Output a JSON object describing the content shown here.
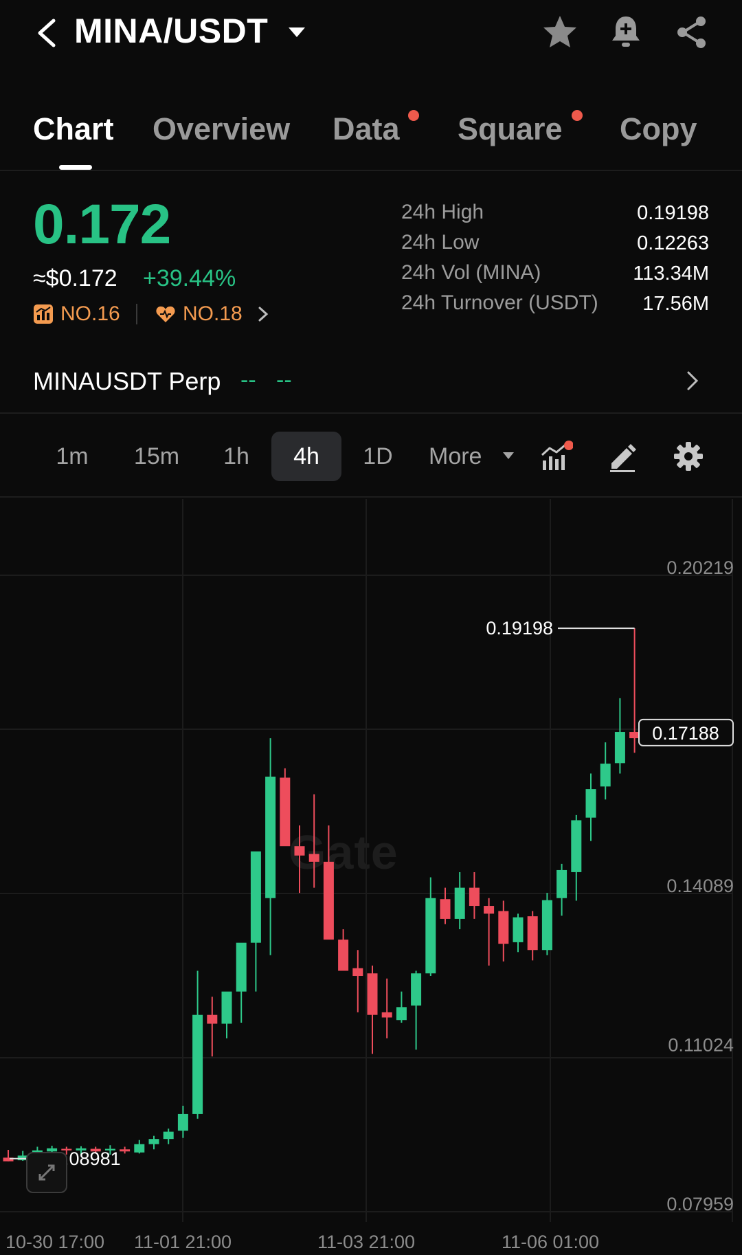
{
  "header": {
    "pair": "MINA/USDT"
  },
  "tabs": [
    {
      "label": "Chart",
      "active": true,
      "dot": false
    },
    {
      "label": "Overview",
      "active": false,
      "dot": false
    },
    {
      "label": "Data",
      "active": false,
      "dot": true
    },
    {
      "label": "Square",
      "active": false,
      "dot": true
    },
    {
      "label": "Copy",
      "active": false,
      "dot": false
    }
  ],
  "price": {
    "last": "0.172",
    "usd": "≈$0.172",
    "change": "+39.44%",
    "rank1": "NO.16",
    "rank2": "NO.18"
  },
  "stats": [
    {
      "label": "24h High",
      "value": "0.19198"
    },
    {
      "label": "24h Low",
      "value": "0.12263"
    },
    {
      "label": "24h Vol (MINA)",
      "value": "113.34M"
    },
    {
      "label": "24h Turnover (USDT)",
      "value": "17.56M"
    }
  ],
  "perp": {
    "name": "MINAUSDT Perp",
    "dash1": "--",
    "dash2": "--"
  },
  "intervals": [
    {
      "label": "1m",
      "active": false
    },
    {
      "label": "15m",
      "active": false
    },
    {
      "label": "1h",
      "active": false
    },
    {
      "label": "4h",
      "active": true
    },
    {
      "label": "1D",
      "active": false
    },
    {
      "label": "More",
      "active": false
    }
  ],
  "colors": {
    "up": "#2ec98a",
    "down": "#ee4d5c",
    "accent_green": "#28c285",
    "rank_orange": "#f49b50",
    "dot_red": "#ef5a4c"
  },
  "watermark": "Gate",
  "chart_data": {
    "type": "candlestick",
    "y_ticks": [
      "0.20219",
      "0.14089",
      "0.11024",
      "0.07959"
    ],
    "x_ticks": [
      "10-30 17:00",
      "11-01 21:00",
      "11-03 21:00",
      "11-06 01:00"
    ],
    "ylim": [
      0.07959,
      0.20219
    ],
    "high_label": "0.19198",
    "low_label": "0.08981",
    "last_price_label": "0.17188",
    "candles": [
      {
        "o": 0.09,
        "h": 0.0915,
        "l": 0.0893,
        "c": 0.0893
      },
      {
        "o": 0.0895,
        "h": 0.0913,
        "l": 0.0894,
        "c": 0.0904
      },
      {
        "o": 0.0905,
        "h": 0.0921,
        "l": 0.0898,
        "c": 0.0914
      },
      {
        "o": 0.0912,
        "h": 0.0923,
        "l": 0.0906,
        "c": 0.0918
      },
      {
        "o": 0.0917,
        "h": 0.0921,
        "l": 0.0906,
        "c": 0.0914
      },
      {
        "o": 0.0914,
        "h": 0.0922,
        "l": 0.0906,
        "c": 0.0918
      },
      {
        "o": 0.0917,
        "h": 0.0921,
        "l": 0.0908,
        "c": 0.0912
      },
      {
        "o": 0.0914,
        "h": 0.0924,
        "l": 0.0906,
        "c": 0.0917
      },
      {
        "o": 0.0916,
        "h": 0.0921,
        "l": 0.0908,
        "c": 0.0912
      },
      {
        "o": 0.091,
        "h": 0.0934,
        "l": 0.0908,
        "c": 0.0926
      },
      {
        "o": 0.0926,
        "h": 0.0942,
        "l": 0.0916,
        "c": 0.0936
      },
      {
        "o": 0.0936,
        "h": 0.0956,
        "l": 0.0926,
        "c": 0.095
      },
      {
        "o": 0.0952,
        "h": 0.1,
        "l": 0.0938,
        "c": 0.0984
      },
      {
        "o": 0.0984,
        "h": 0.126,
        "l": 0.0975,
        "c": 0.1175
      },
      {
        "o": 0.1175,
        "h": 0.121,
        "l": 0.1095,
        "c": 0.1158
      },
      {
        "o": 0.1158,
        "h": 0.1216,
        "l": 0.113,
        "c": 0.122
      },
      {
        "o": 0.122,
        "h": 0.127,
        "l": 0.116,
        "c": 0.1314
      },
      {
        "o": 0.1314,
        "h": 0.14,
        "l": 0.122,
        "c": 0.149
      },
      {
        "o": 0.14,
        "h": 0.1708,
        "l": 0.129,
        "c": 0.1634
      },
      {
        "o": 0.1632,
        "h": 0.165,
        "l": 0.16,
        "c": 0.15
      },
      {
        "o": 0.15,
        "h": 0.154,
        "l": 0.141,
        "c": 0.1482
      },
      {
        "o": 0.1485,
        "h": 0.16,
        "l": 0.142,
        "c": 0.147
      },
      {
        "o": 0.147,
        "h": 0.154,
        "l": 0.142,
        "c": 0.132
      },
      {
        "o": 0.132,
        "h": 0.134,
        "l": 0.128,
        "c": 0.126
      },
      {
        "o": 0.1265,
        "h": 0.13,
        "l": 0.118,
        "c": 0.125
      },
      {
        "o": 0.1255,
        "h": 0.127,
        "l": 0.11,
        "c": 0.1175
      },
      {
        "o": 0.118,
        "h": 0.1245,
        "l": 0.113,
        "c": 0.117
      },
      {
        "o": 0.1165,
        "h": 0.122,
        "l": 0.116,
        "c": 0.119
      },
      {
        "o": 0.1193,
        "h": 0.126,
        "l": 0.1108,
        "c": 0.1255
      },
      {
        "o": 0.1255,
        "h": 0.144,
        "l": 0.125,
        "c": 0.14
      },
      {
        "o": 0.1398,
        "h": 0.142,
        "l": 0.135,
        "c": 0.136
      },
      {
        "o": 0.136,
        "h": 0.145,
        "l": 0.134,
        "c": 0.142
      },
      {
        "o": 0.142,
        "h": 0.145,
        "l": 0.136,
        "c": 0.1385
      },
      {
        "o": 0.1385,
        "h": 0.14,
        "l": 0.127,
        "c": 0.137
      },
      {
        "o": 0.1375,
        "h": 0.1395,
        "l": 0.1278,
        "c": 0.1312
      },
      {
        "o": 0.1315,
        "h": 0.137,
        "l": 0.1296,
        "c": 0.1363
      },
      {
        "o": 0.1365,
        "h": 0.1375,
        "l": 0.128,
        "c": 0.13
      },
      {
        "o": 0.13,
        "h": 0.141,
        "l": 0.129,
        "c": 0.1396
      },
      {
        "o": 0.14,
        "h": 0.1466,
        "l": 0.1366,
        "c": 0.1454
      },
      {
        "o": 0.145,
        "h": 0.156,
        "l": 0.1395,
        "c": 0.155
      },
      {
        "o": 0.1555,
        "h": 0.164,
        "l": 0.151,
        "c": 0.161
      },
      {
        "o": 0.1615,
        "h": 0.17,
        "l": 0.159,
        "c": 0.1659
      },
      {
        "o": 0.166,
        "h": 0.1785,
        "l": 0.164,
        "c": 0.172
      },
      {
        "o": 0.172,
        "h": 0.192,
        "l": 0.168,
        "c": 0.1708
      }
    ]
  }
}
